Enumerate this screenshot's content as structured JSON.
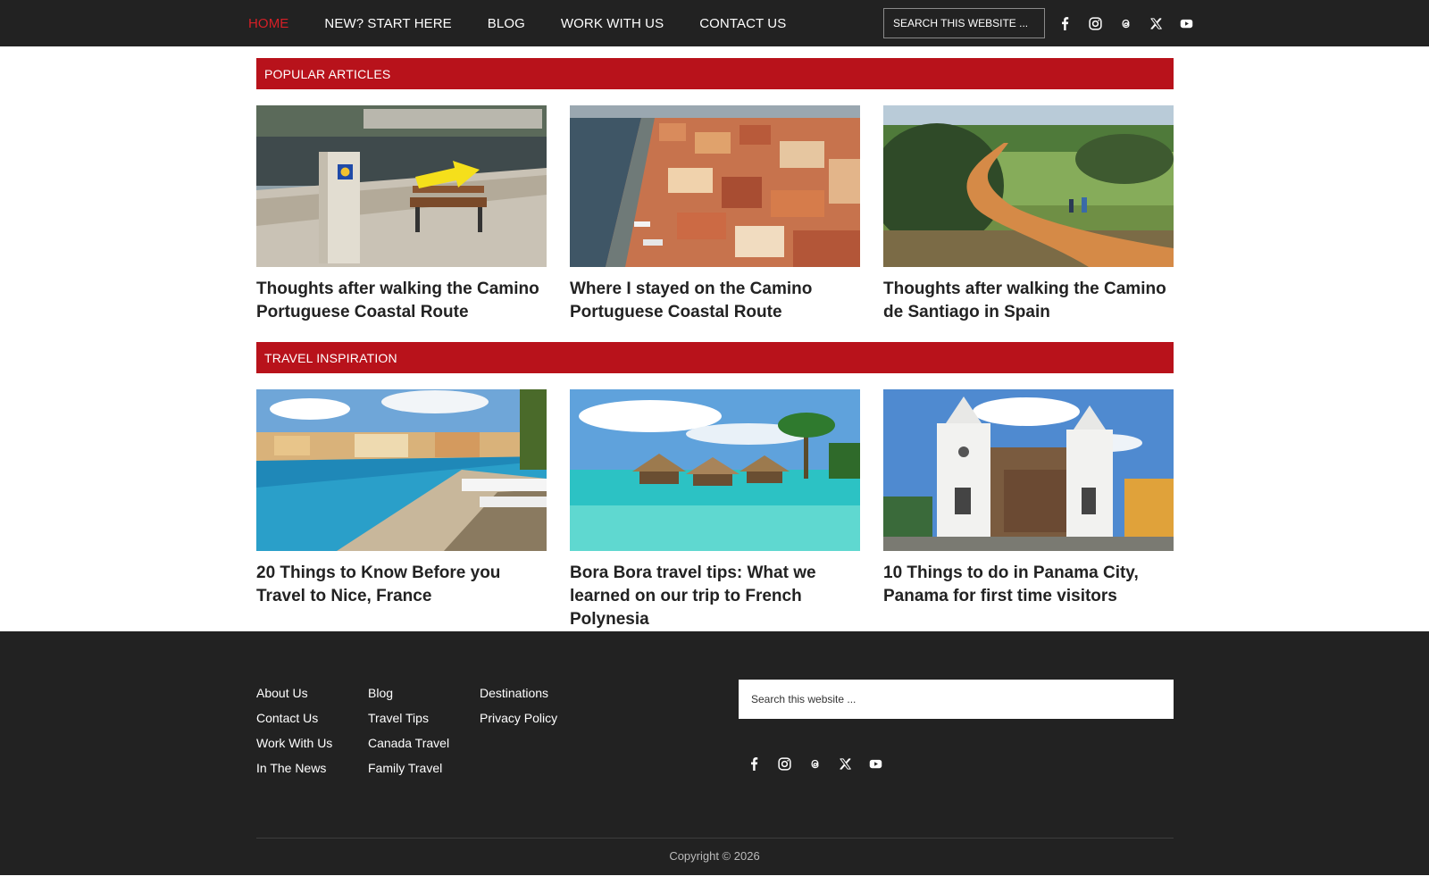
{
  "nav": {
    "items": [
      {
        "label": "HOME",
        "active": true
      },
      {
        "label": "NEW? START HERE",
        "active": false
      },
      {
        "label": "BLOG",
        "active": false
      },
      {
        "label": "WORK WITH US",
        "active": false
      },
      {
        "label": "CONTACT US",
        "active": false
      }
    ],
    "search_placeholder": "SEARCH THIS WEBSITE ...",
    "social": [
      "facebook-icon",
      "instagram-icon",
      "threads-icon",
      "x-icon",
      "youtube-icon"
    ]
  },
  "popular": {
    "heading": "POPULAR ARTICLES",
    "articles": [
      {
        "title": "Thoughts after walking the Camino Portuguese Coastal Route",
        "image": "camino-marker-bench-photo"
      },
      {
        "title": "Where I stayed on the Camino Portuguese Coastal Route",
        "image": "porto-riverside-aerial-photo"
      },
      {
        "title": "Thoughts after walking the Camino de Santiago in Spain",
        "image": "countryside-trail-walkers-photo"
      }
    ]
  },
  "inspiration": {
    "heading": "TRAVEL INSPIRATION",
    "articles": [
      {
        "title": "20 Things to Know Before you Travel to Nice, France",
        "image": "nice-beach-photo"
      },
      {
        "title": "Bora Bora travel tips: What we learned on our trip to French Polynesia",
        "image": "overwater-bungalows-photo"
      },
      {
        "title": "10 Things to do in Panama City, Panama for first time visitors",
        "image": "panama-cathedral-photo"
      }
    ]
  },
  "footer": {
    "col1": [
      "About Us",
      "Contact Us",
      "Work With Us",
      "In The News"
    ],
    "col2": [
      "Blog",
      "Travel Tips",
      "Canada Travel",
      "Family Travel"
    ],
    "col3": [
      "Destinations",
      "Privacy Policy"
    ],
    "search_placeholder": "Search this website ...",
    "social": [
      "facebook-icon",
      "instagram-icon",
      "threads-icon",
      "x-icon",
      "youtube-icon"
    ],
    "copyright": "Copyright © 2026"
  },
  "colors": {
    "nav_bg": "#222222",
    "accent_red": "#b8121b",
    "active_nav": "#d61f26",
    "footer_bg": "#222222"
  }
}
